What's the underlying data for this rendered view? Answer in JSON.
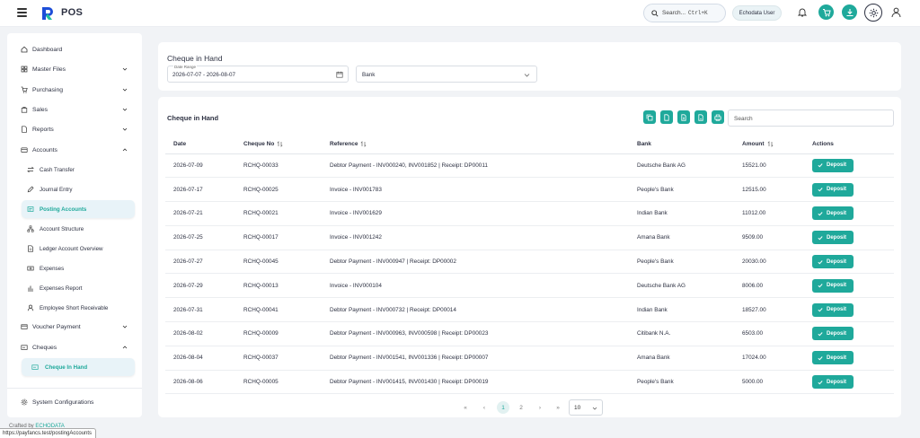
{
  "app": {
    "title": "POS"
  },
  "header": {
    "search_label": "Search...",
    "search_shortcut": "Ctrl+K",
    "user_label": "Echodata User"
  },
  "sidebar": {
    "items": [
      {
        "label": "Dashboard",
        "icon": "home-icon"
      },
      {
        "label": "Master Files",
        "icon": "grid-icon",
        "expandable": true
      },
      {
        "label": "Purchasing",
        "icon": "cart-icon",
        "expandable": true
      },
      {
        "label": "Sales",
        "icon": "bag-icon",
        "expandable": true
      },
      {
        "label": "Reports",
        "icon": "document-icon",
        "expandable": true
      },
      {
        "label": "Accounts",
        "icon": "wallet-icon",
        "expandable": true,
        "expanded": true
      }
    ],
    "accounts_children": [
      {
        "label": "Cash Transfer",
        "icon": "transfer-icon"
      },
      {
        "label": "Journal Entry",
        "icon": "pen-icon"
      },
      {
        "label": "Posting Accounts",
        "icon": "posting-icon",
        "active": true
      },
      {
        "label": "Account Structure",
        "icon": "structure-icon"
      },
      {
        "label": "Ledger Account Overview",
        "icon": "ledger-icon"
      },
      {
        "label": "Expenses",
        "icon": "money-icon"
      },
      {
        "label": "Expenses Report",
        "icon": "bar-chart-icon"
      },
      {
        "label": "Employee Short Receivable",
        "icon": "employee-icon"
      }
    ],
    "more_items": [
      {
        "label": "Voucher Payment",
        "icon": "voucher-icon",
        "expandable": true
      },
      {
        "label": "Cheques",
        "icon": "cheque-icon",
        "expandable": true,
        "expanded": true
      }
    ],
    "cheques_children": [
      {
        "label": "Cheque In Hand",
        "icon": "cheque-icon",
        "active": true
      }
    ],
    "system_config": "System Configurations"
  },
  "filter_card": {
    "title": "Cheque in Hand",
    "date_range_label": "Date Range",
    "date_range_value": "2026-07-07 - 2026-08-07",
    "bank_value": "Bank"
  },
  "table_card": {
    "title": "Cheque in Hand",
    "search_placeholder": "Search",
    "columns": [
      "Date",
      "Cheque No",
      "Reference",
      "Bank",
      "Amount",
      "Actions"
    ],
    "deposit_label": "Deposit",
    "rows": [
      {
        "date": "2026-07-09",
        "cheque_no": "RCHQ-00033",
        "reference": "Debtor Payment - INV000240, INV001852 | Receipt: DP00011",
        "bank": "Deutsche Bank AG",
        "amount": "15521.00"
      },
      {
        "date": "2026-07-17",
        "cheque_no": "RCHQ-00025",
        "reference": "Invoice - INV001783",
        "bank": "People's Bank",
        "amount": "12515.00"
      },
      {
        "date": "2026-07-21",
        "cheque_no": "RCHQ-00021",
        "reference": "Invoice - INV001629",
        "bank": "Indian Bank",
        "amount": "11012.00"
      },
      {
        "date": "2026-07-25",
        "cheque_no": "RCHQ-00017",
        "reference": "Invoice - INV001242",
        "bank": "Amana Bank",
        "amount": "9509.00"
      },
      {
        "date": "2026-07-27",
        "cheque_no": "RCHQ-00045",
        "reference": "Debtor Payment - INV000947 | Receipt: DP00002",
        "bank": "People's Bank",
        "amount": "20030.00"
      },
      {
        "date": "2026-07-29",
        "cheque_no": "RCHQ-00013",
        "reference": "Invoice - INV000104",
        "bank": "Deutsche Bank AG",
        "amount": "8006.00"
      },
      {
        "date": "2026-07-31",
        "cheque_no": "RCHQ-00041",
        "reference": "Debtor Payment - INV000732 | Receipt: DP00014",
        "bank": "Indian Bank",
        "amount": "18527.00"
      },
      {
        "date": "2026-08-02",
        "cheque_no": "RCHQ-00009",
        "reference": "Debtor Payment - INV000963, INV000598 | Receipt: DP00023",
        "bank": "Citibank N.A.",
        "amount": "6503.00"
      },
      {
        "date": "2026-08-04",
        "cheque_no": "RCHQ-00037",
        "reference": "Debtor Payment - INV001541, INV001336 | Receipt: DP00007",
        "bank": "Amana Bank",
        "amount": "17024.00"
      },
      {
        "date": "2026-08-06",
        "cheque_no": "RCHQ-00005",
        "reference": "Debtor Payment - INV001415, INV001430 | Receipt: DP00019",
        "bank": "People's Bank",
        "amount": "5000.00"
      }
    ]
  },
  "pagination": {
    "current": "1",
    "next": "2",
    "page_size": "10"
  },
  "footer": {
    "credit_prefix": "Crafted by",
    "credit_brand": "ECHODATA"
  },
  "status_url": "https://payfancs.test/postingAccounts",
  "colors": {
    "accent": "#1fa99b",
    "active_bg": "#e8f3f8"
  }
}
